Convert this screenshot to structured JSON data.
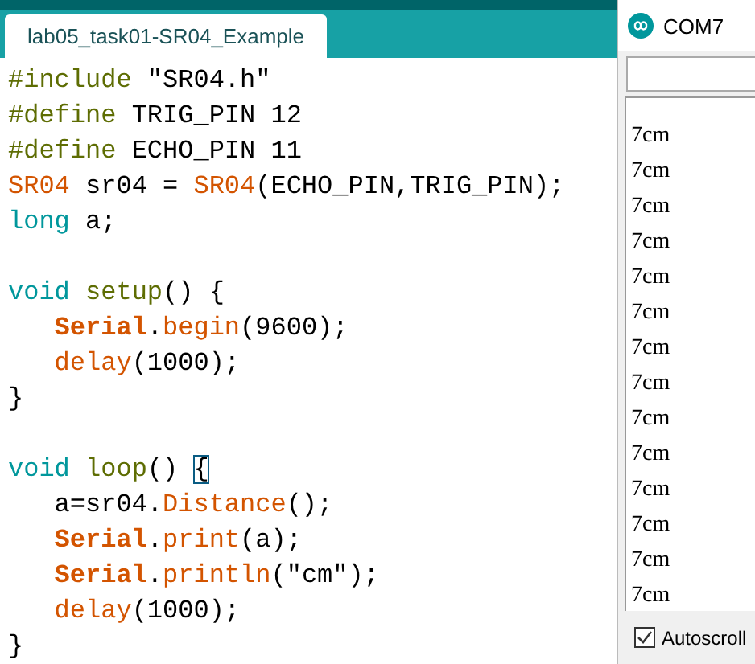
{
  "editor": {
    "tab": {
      "label": "lab05_task01-SR04_Example",
      "selected": true
    },
    "lines": [
      {
        "kind": "code",
        "tokens": [
          {
            "kind": "directive",
            "text": "#include"
          },
          {
            "kind": "plain",
            "text": " \"SR04.h\""
          }
        ]
      },
      {
        "kind": "code",
        "tokens": [
          {
            "kind": "directive",
            "text": "#define"
          },
          {
            "kind": "plain",
            "text": " TRIG_PIN 12"
          }
        ]
      },
      {
        "kind": "code",
        "tokens": [
          {
            "kind": "directive",
            "text": "#define"
          },
          {
            "kind": "plain",
            "text": " ECHO_PIN 11"
          }
        ]
      },
      {
        "kind": "code",
        "tokens": [
          {
            "kind": "class",
            "text": "SR04"
          },
          {
            "kind": "plain",
            "text": " sr04 = "
          },
          {
            "kind": "class",
            "text": "SR04"
          },
          {
            "kind": "plain",
            "text": "(ECHO_PIN,TRIG_PIN);"
          }
        ]
      },
      {
        "kind": "code",
        "tokens": [
          {
            "kind": "keyword",
            "text": "long"
          },
          {
            "kind": "plain",
            "text": " a;"
          }
        ]
      },
      {
        "kind": "blank"
      },
      {
        "kind": "code",
        "tokens": [
          {
            "kind": "keyword",
            "text": "void "
          },
          {
            "kind": "directive",
            "text": "setup"
          },
          {
            "kind": "plain",
            "text": "() {"
          }
        ]
      },
      {
        "kind": "code",
        "indented": true,
        "tokens": [
          {
            "kind": "serial",
            "text": "Serial"
          },
          {
            "kind": "plain",
            "text": "."
          },
          {
            "kind": "function",
            "text": "begin"
          },
          {
            "kind": "plain",
            "text": "(9600);"
          }
        ]
      },
      {
        "kind": "code",
        "indented": true,
        "tokens": [
          {
            "kind": "function",
            "text": "delay"
          },
          {
            "kind": "plain",
            "text": "(1000);"
          }
        ]
      },
      {
        "kind": "code",
        "tokens": [
          {
            "kind": "plain",
            "text": "}"
          }
        ]
      },
      {
        "kind": "blank"
      },
      {
        "kind": "code",
        "tokens": [
          {
            "kind": "keyword",
            "text": "void "
          },
          {
            "kind": "directive",
            "text": "loop"
          },
          {
            "kind": "plain",
            "text": "() "
          },
          {
            "kind": "matched_bracket",
            "text": "{"
          }
        ]
      },
      {
        "kind": "code",
        "indented": true,
        "tokens": [
          {
            "kind": "plain",
            "text": "a=sr04."
          },
          {
            "kind": "function",
            "text": "Distance"
          },
          {
            "kind": "plain",
            "text": "();"
          }
        ]
      },
      {
        "kind": "code",
        "indented": true,
        "tokens": [
          {
            "kind": "serial",
            "text": "Serial"
          },
          {
            "kind": "plain",
            "text": "."
          },
          {
            "kind": "function",
            "text": "print"
          },
          {
            "kind": "plain",
            "text": "(a);"
          }
        ]
      },
      {
        "kind": "code",
        "indented": true,
        "tokens": [
          {
            "kind": "serial",
            "text": "Serial"
          },
          {
            "kind": "plain",
            "text": "."
          },
          {
            "kind": "function",
            "text": "println"
          },
          {
            "kind": "plain",
            "text": "(\"cm\");"
          }
        ]
      },
      {
        "kind": "code",
        "indented": true,
        "tokens": [
          {
            "kind": "function",
            "text": "delay"
          },
          {
            "kind": "plain",
            "text": "(1000);"
          }
        ]
      },
      {
        "kind": "code",
        "tokens": [
          {
            "kind": "plain",
            "text": "}"
          }
        ]
      }
    ]
  },
  "serial_monitor": {
    "title": "COM7",
    "output": [
      "7cm",
      "7cm",
      "7cm",
      "7cm",
      "7cm",
      "7cm",
      "7cm",
      "7cm",
      "7cm",
      "7cm",
      "7cm",
      "7cm",
      "7cm",
      "7cm"
    ],
    "autoscroll": {
      "label": "Autoscroll",
      "checked": true
    }
  }
}
